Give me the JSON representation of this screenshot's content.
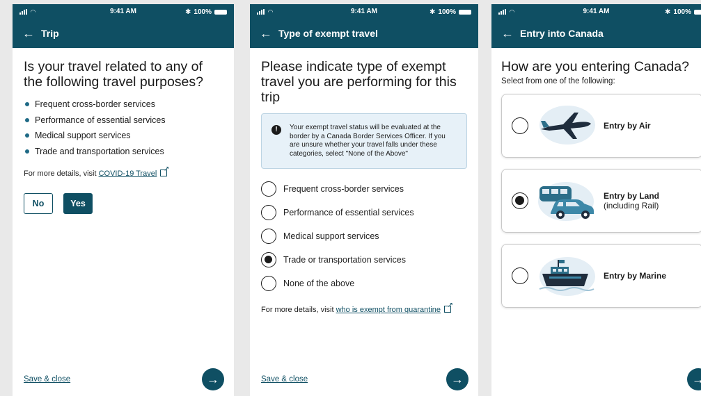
{
  "status": {
    "time": "9:41 AM",
    "battery": "100%"
  },
  "screen1": {
    "nav_title": "Trip",
    "heading": "Is your travel related to any of the following travel purposes?",
    "purposes": [
      "Frequent cross-border services",
      "Performance of essential services",
      "Medical support services",
      "Trade and transportation services"
    ],
    "details_prefix": "For more details, visit",
    "details_link": "COVID-19 Travel",
    "no_label": "No",
    "yes_label": "Yes",
    "save_close": "Save & close"
  },
  "screen2": {
    "nav_title": "Type of exempt travel",
    "heading": "Please indicate type of exempt travel you are performing  for this trip",
    "info_icon": "info-icon",
    "info_text": "Your exempt travel status will be evaluated at the border by a Canada Border Services Officer. If you are unsure whether your travel falls under these categories, select \"None of the Above\"",
    "options": [
      {
        "label": "Frequent cross-border services",
        "selected": false
      },
      {
        "label": "Performance of essential services",
        "selected": false
      },
      {
        "label": "Medical support services",
        "selected": false
      },
      {
        "label": "Trade or transportation services",
        "selected": true
      },
      {
        "label": "None of the above",
        "selected": false
      }
    ],
    "details_prefix": "For more details, visit",
    "details_link": "who is exempt from quarantine",
    "save_close": "Save & close"
  },
  "screen3": {
    "nav_title": "Entry into Canada",
    "heading": "How are you entering Canada?",
    "subtitle": "Select from one of the following:",
    "options": [
      {
        "title": "Entry by Air",
        "subtitle": "",
        "selected": false,
        "icon": "airplane-icon"
      },
      {
        "title": "Entry by Land",
        "subtitle": "(including Rail)",
        "selected": true,
        "icon": "car-train-icon"
      },
      {
        "title": "Entry by Marine",
        "subtitle": "",
        "selected": false,
        "icon": "ship-icon"
      }
    ]
  },
  "colors": {
    "brand": "#0f4f63",
    "info_bg": "#e7f1f8",
    "illustration_bg": "#e4eef5",
    "vehicle": "#2c6e89"
  }
}
